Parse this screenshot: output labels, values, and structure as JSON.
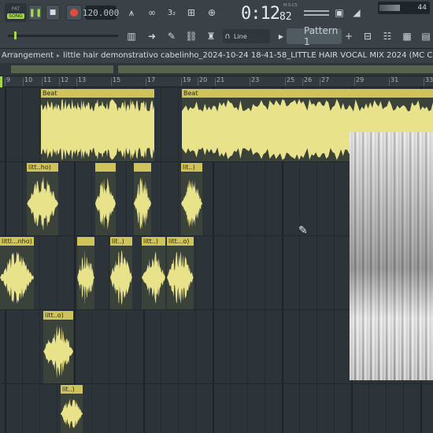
{
  "toolbar": {
    "pat_label": "PAT",
    "song_label": "SONG",
    "tempo": "120.000",
    "time_main": "0:12",
    "time_small": "82",
    "time_format": "M:S:CS",
    "cpu_value": "44",
    "snap_mode": "Line",
    "pattern": "Pattern 1",
    "icons": [
      "play-icon",
      "stop-icon",
      "record-icon",
      "metronome-icon",
      "loop-record-icon",
      "step-edit-icon",
      "typing-keyboard-icon",
      "blend-notes-icon",
      "piano-icon",
      "arrow-icon",
      "brush-icon",
      "link-icon",
      "hat-icon",
      "magnet-icon",
      "plus-icon",
      "mixer-icon",
      "channel-rack-icon",
      "browser-icon"
    ]
  },
  "breadcrumb": {
    "root": "Arrangement",
    "file": "little hair demonstrativo cabelinho_2024-10-24 18-41-58_LITTLE HAIR VOCAL MIX 2024 (MC Cabelinho"
  },
  "ruler": {
    "ticks": [
      "9",
      "10",
      "11",
      "12",
      "13",
      "15",
      "17",
      "19",
      "20",
      "21",
      "23",
      "25",
      "26",
      "27",
      "29",
      "31",
      "33"
    ]
  },
  "clips": {
    "beat_1": "Beat",
    "beat_2": "Beat",
    "t2_c1": "litt..ho)",
    "t2_c2": "",
    "t2_c3": "",
    "t2_c4": "lit..)",
    "t3_c1": "littl...nho)",
    "t3_c2": "",
    "t3_c3": "lit..)",
    "t3_c4": "litt..)",
    "t3_c5": "litt...o)",
    "t4_c1": "litt..o)",
    "t5_c1": "lit..)"
  },
  "colors": {
    "clip_header": "#cfc35a",
    "waveform": "#e8e28a",
    "accent": "#a6d64a",
    "record": "#e24b3d"
  }
}
